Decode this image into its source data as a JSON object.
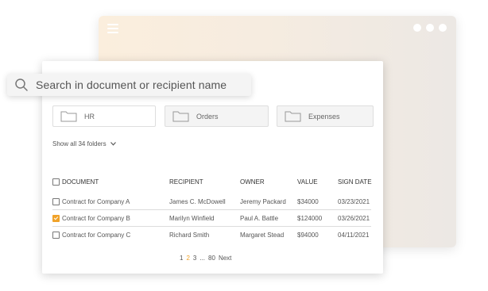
{
  "search": {
    "placeholder": "Search in document or recipient name"
  },
  "folders": [
    {
      "label": "HR"
    },
    {
      "label": "Orders"
    },
    {
      "label": "Expenses"
    }
  ],
  "show_all": "Show all 34 folders",
  "table": {
    "headers": [
      "DOCUMENT",
      "RECIPIENT",
      "OWNER",
      "VALUE",
      "SIGN DATE"
    ],
    "rows": [
      {
        "document": "Contract for Company A",
        "recipient": "James C. McDowell",
        "owner": "Jeremy Packard",
        "value": "$34000",
        "date": "03/23/2021",
        "checked": false
      },
      {
        "document": "Contract for Company B",
        "recipient": "Marilyn Winfield",
        "owner": "Paul A. Battle",
        "value": "$124000",
        "date": "03/26/2021",
        "checked": true
      },
      {
        "document": "Contract for Company C",
        "recipient": "Richard Smith",
        "owner": "Margaret Stead",
        "value": "$94000",
        "date": "04/11/2021",
        "checked": false
      }
    ]
  },
  "pagination": {
    "pages": [
      "1",
      "2",
      "3"
    ],
    "ellipsis": "...",
    "last": "80",
    "next": "Next",
    "current": "2"
  },
  "colors": {
    "accent": "#f0a229"
  }
}
